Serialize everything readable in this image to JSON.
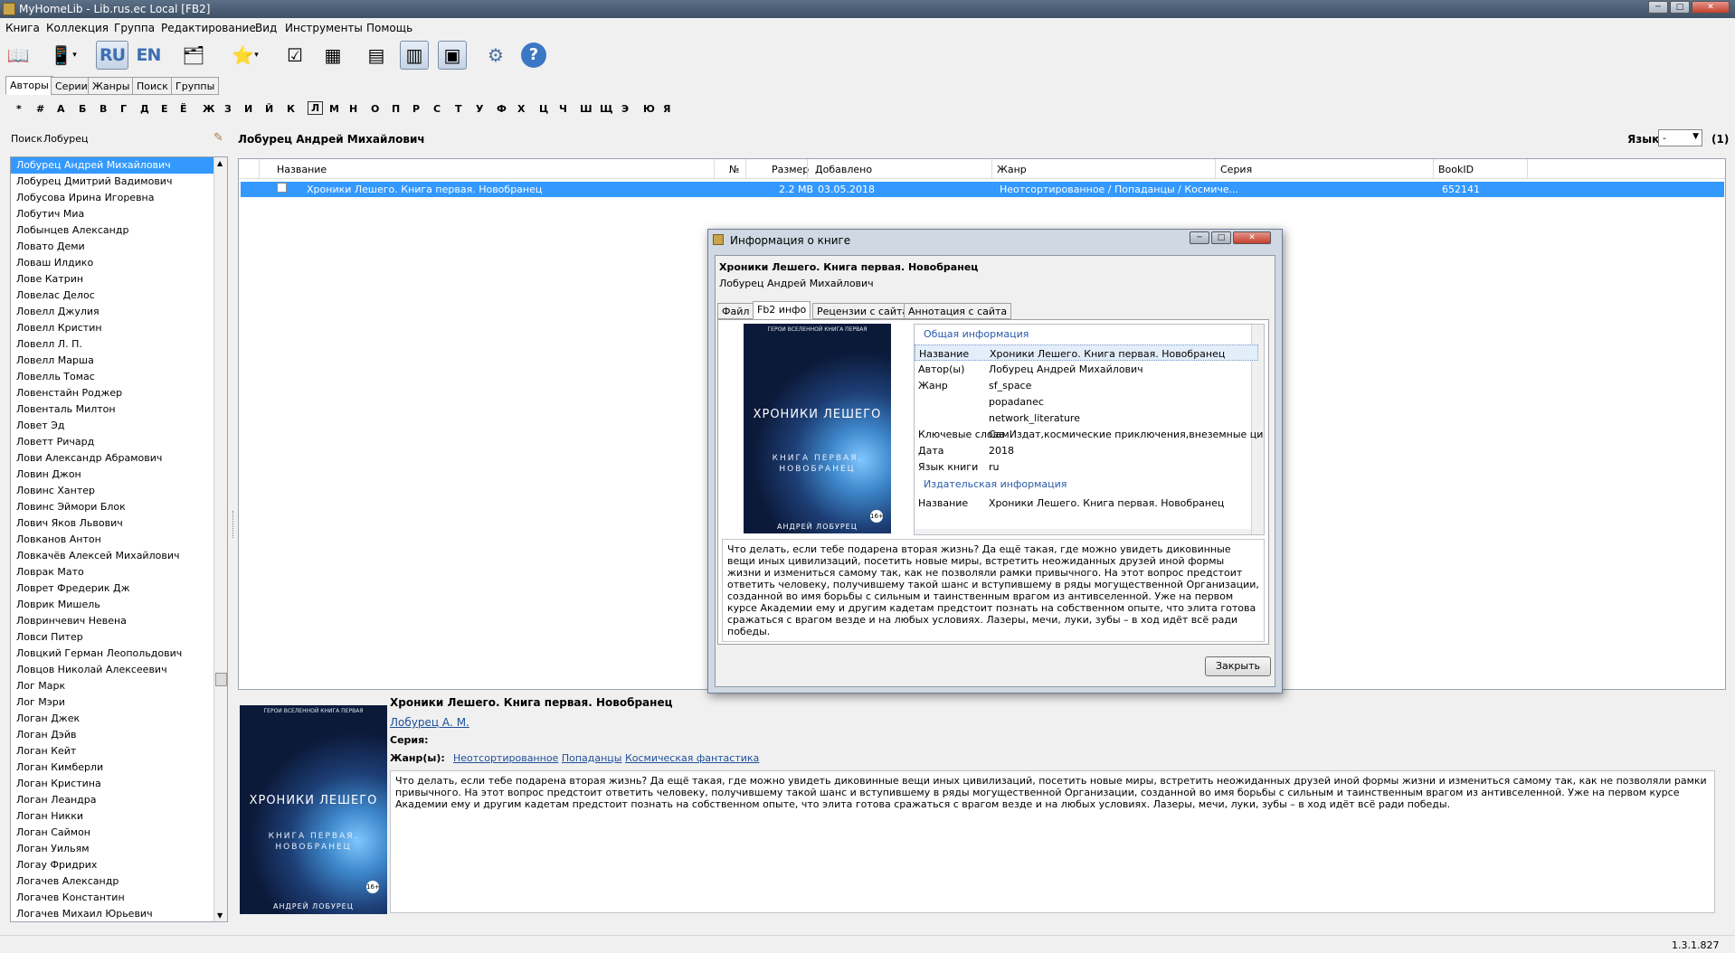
{
  "window": {
    "title": "MyHomeLib - Lib.rus.ec Local [FB2]"
  },
  "menu": [
    "Книга",
    "Коллекция",
    "Группа",
    "Редактирование",
    "Вид",
    "Инструменты",
    "Помощь"
  ],
  "toolbar": {
    "lang_ru": "RU",
    "lang_en": "EN"
  },
  "tabs": [
    "Авторы",
    "Серии",
    "Жанры",
    "Поиск",
    "Группы"
  ],
  "alphabet": [
    "*",
    "#",
    "А",
    "Б",
    "В",
    "Г",
    "Д",
    "Е",
    "Ё",
    "Ж",
    "З",
    "И",
    "Й",
    "К",
    "Л",
    "М",
    "Н",
    "О",
    "П",
    "Р",
    "С",
    "Т",
    "У",
    "Ф",
    "Х",
    "Ц",
    "Ч",
    "Ш",
    "Щ",
    "Э",
    "Ю",
    "Я"
  ],
  "search": {
    "label": "Поиск",
    "value": "Лобурец"
  },
  "authors": [
    "Лобурец Андрей Михайлович",
    "Лобурец Дмитрий Вадимович",
    "Лобусова Ирина Игоревна",
    "Лобутич Миа",
    "Лобынцев Александр",
    "Ловато Деми",
    "Ловаш Илдико",
    "Лове Катрин",
    "Ловелас Делос",
    "Ловелл Джулия",
    "Ловелл Кристин",
    "Ловелл Л. П.",
    "Ловелл Марша",
    "Ловелль Томас",
    "Ловенстайн Роджер",
    "Ловенталь Милтон",
    "Ловет Эд",
    "Ловетт Ричард",
    "Лови Александр Абрамович",
    "Ловин Джон",
    "Ловинс Хантер",
    "Ловинс Эймори Блок",
    "Лович Яков Львович",
    "Ловканов Антон",
    "Ловкачёв Алексей Михайлович",
    "Ловрак Мато",
    "Ловрет Фредерик Дж",
    "Ловрик Мишель",
    "Ловринчевич Невена",
    "Ловси Питер",
    "Ловцкий Герман Леопольдович",
    "Ловцов Николай Алексеевич",
    "Лог Марк",
    "Лог Мэри",
    "Логан Джек",
    "Логан Дэйв",
    "Логан Кейт",
    "Логан Кимберли",
    "Логан Кристина",
    "Логан Леандра",
    "Логан Никки",
    "Логан Саймон",
    "Логан Уильям",
    "Логау Фридрих",
    "Логачев Александр",
    "Логачев Константин",
    "Логачев Михаил Юрьевич"
  ],
  "author_header": "Лобурец Андрей Михайлович",
  "lang_filter": {
    "label": "Язык",
    "value": "-",
    "count": "(1)"
  },
  "grid": {
    "columns": [
      "Название",
      "№",
      "Размер",
      "Добавлено",
      "Жанр",
      "Серия",
      "BookID"
    ],
    "rows": [
      {
        "title": "Хроники Лешего. Книга первая. Новобранец",
        "num": "",
        "size": "2.2 MB",
        "added": "03.05.2018",
        "genre": "Неотсортированное / Попаданцы / Космиче...",
        "series": "",
        "id": "652141"
      }
    ]
  },
  "cover": {
    "top": "ГЕРОИ ВСЕЛЕННОЙ КНИГА ПЕРВАЯ",
    "title": "ХРОНИКИ ЛЕШЕГО",
    "subtitle1": "КНИГА ПЕРВАЯ.",
    "subtitle2": "НОВОБРАНЕЦ",
    "author": "АНДРЕЙ ЛОБУРЕЦ",
    "badge": "16+"
  },
  "book": {
    "title": "Хроники Лешего. Книга первая. Новобранец",
    "author_link": "Лобурец А. М.",
    "series_label": "Серия:",
    "genre_label": "Жанр(ы):",
    "genres": [
      "Неотсортированное",
      "Попаданцы",
      "Космическая фантастика"
    ],
    "annotation": "Что делать, если тебе подарена вторая жизнь? Да ещё такая, где можно увидеть диковинные вещи иных цивилизаций, посетить новые миры, встретить неожиданных друзей иной формы жизни и измениться самому так, как не позволяли рамки привычного. На этот вопрос предстоит ответить человеку, получившему такой шанс и вступившему в ряды могущественной Организации, созданной во имя борьбы с сильным и таинственным врагом из антивселенной. Уже на первом курсе Академии ему и другим кадетам предстоит познать на собственном опыте, что элита готова сражаться с врагом везде и на любых условиях. Лазеры, мечи, луки, зубы – в ход идёт всё ради победы."
  },
  "dialog": {
    "title": "Информация о книге",
    "book_title": "Хроники Лешего. Книга первая. Новобранец",
    "book_author": "Лобурец Андрей Михайлович",
    "tabs": [
      "Файл",
      "Fb2 инфо",
      "Рецензии с сайта",
      "Аннотация с сайта"
    ],
    "section_general": "Общая информация",
    "props": [
      {
        "k": "Название",
        "v": "Хроники Лешего. Книга первая. Новобранец"
      },
      {
        "k": "Автор(ы)",
        "v": "Лобурец Андрей Михайлович"
      },
      {
        "k": "Жанр",
        "v": "sf_space"
      },
      {
        "k": "",
        "v": "popadanec"
      },
      {
        "k": "",
        "v": "network_literature"
      },
      {
        "k": "Ключевые слова",
        "v": "СамИздат,космические приключения,внеземные ци"
      },
      {
        "k": "Дата",
        "v": "2018"
      },
      {
        "k": "Язык книги",
        "v": "ru"
      }
    ],
    "section_publish": "Издательская информация",
    "pub_props": [
      {
        "k": "Название",
        "v": "Хроники Лешего. Книга первая. Новобранец"
      }
    ],
    "close": "Закрыть"
  },
  "version": "1.3.1.827"
}
